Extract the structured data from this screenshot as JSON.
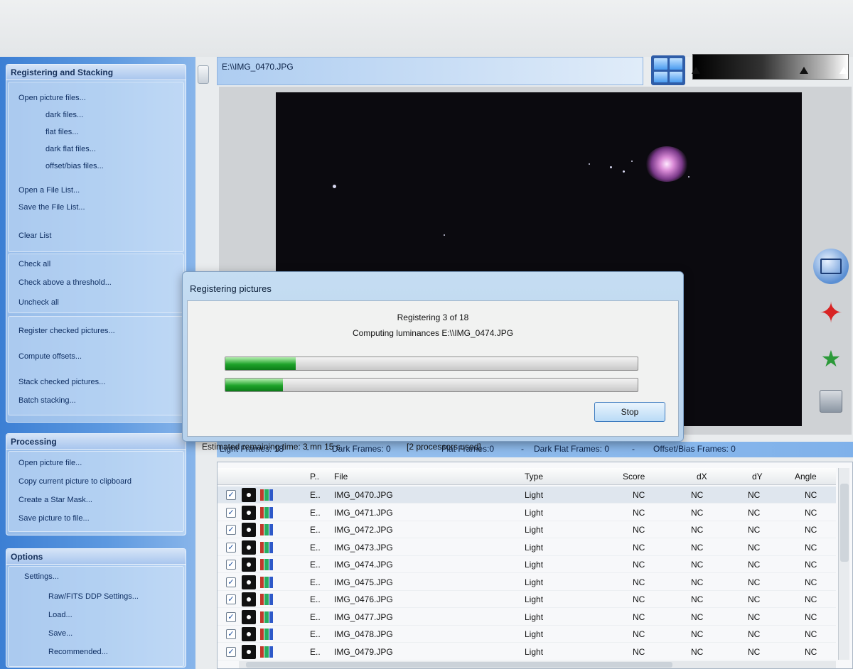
{
  "left_panel": {
    "registering": {
      "header": "Registering and Stacking",
      "items": [
        "Open picture files...",
        "dark files...",
        "flat files...",
        "dark flat files...",
        "offset/bias files...",
        "Open a File List...",
        "Save the File List...",
        "Clear List",
        "Check all",
        "Check above a threshold...",
        "Uncheck all",
        "Register checked pictures...",
        "Compute offsets...",
        "Stack checked pictures...",
        "Batch stacking..."
      ]
    },
    "processing": {
      "header": "Processing",
      "items": [
        "Open picture file...",
        "Copy current picture to clipboard",
        "Create a Star Mask...",
        "Save picture to file..."
      ]
    },
    "options": {
      "header": "Options",
      "items": [
        "Settings...",
        "Raw/FITS DDP Settings...",
        "Load...",
        "Save...",
        "Recommended..."
      ]
    }
  },
  "viewer": {
    "path": "E:\\\\IMG_0470.JPG"
  },
  "dialog": {
    "title": "Registering pictures",
    "line1": "Registering 3 of 18",
    "line2": "Computing luminances E:\\\\IMG_0474.JPG",
    "progress_overall": 0.17,
    "progress_file": 0.14,
    "remaining": "Estimated remaining time: 3 mn 15 s",
    "processors": "[2 processors used]",
    "stop_label": "Stop"
  },
  "counts": {
    "light": "Light Frames: 18",
    "dark": "Dark Frames: 0",
    "flat": "Flat Frames:0",
    "dark_flat": "Dark Flat Frames: 0",
    "offset": "Offset/Bias Frames: 0",
    "sep": "-"
  },
  "table": {
    "columns": [
      "P..",
      "File",
      "Type",
      "Score",
      "dX",
      "dY",
      "Angle"
    ],
    "rows": [
      {
        "path": "E..",
        "file": "IMG_0470.JPG",
        "type": "Light",
        "score": "NC",
        "dx": "NC",
        "dy": "NC",
        "angle": "NC",
        "check": "✓"
      },
      {
        "path": "E..",
        "file": "IMG_0471.JPG",
        "type": "Light",
        "score": "NC",
        "dx": "NC",
        "dy": "NC",
        "angle": "NC",
        "check": "✓"
      },
      {
        "path": "E..",
        "file": "IMG_0472.JPG",
        "type": "Light",
        "score": "NC",
        "dx": "NC",
        "dy": "NC",
        "angle": "NC",
        "check": "✓"
      },
      {
        "path": "E..",
        "file": "IMG_0473.JPG",
        "type": "Light",
        "score": "NC",
        "dx": "NC",
        "dy": "NC",
        "angle": "NC",
        "check": "✓"
      },
      {
        "path": "E..",
        "file": "IMG_0474.JPG",
        "type": "Light",
        "score": "NC",
        "dx": "NC",
        "dy": "NC",
        "angle": "NC",
        "check": "✓"
      },
      {
        "path": "E..",
        "file": "IMG_0475.JPG",
        "type": "Light",
        "score": "NC",
        "dx": "NC",
        "dy": "NC",
        "angle": "NC",
        "check": "✓"
      },
      {
        "path": "E..",
        "file": "IMG_0476.JPG",
        "type": "Light",
        "score": "NC",
        "dx": "NC",
        "dy": "NC",
        "angle": "NC",
        "check": "✓"
      },
      {
        "path": "E..",
        "file": "IMG_0477.JPG",
        "type": "Light",
        "score": "NC",
        "dx": "NC",
        "dy": "NC",
        "angle": "NC",
        "check": "✓"
      },
      {
        "path": "E..",
        "file": "IMG_0478.JPG",
        "type": "Light",
        "score": "NC",
        "dx": "NC",
        "dy": "NC",
        "angle": "NC",
        "check": "✓"
      },
      {
        "path": "E..",
        "file": "IMG_0479.JPG",
        "type": "Light",
        "score": "NC",
        "dx": "NC",
        "dy": "NC",
        "angle": "NC",
        "check": "✓"
      }
    ]
  },
  "icons": {
    "grid": "grid-view-icon",
    "select": "select-rect-icon",
    "star": "star-icon",
    "comet": "comet-icon",
    "save": "save-icon",
    "checkbox": "checkbox-icon",
    "frame_type": "light-frame-icon",
    "color": "rgb-icon"
  },
  "colors": {
    "panel_blue": "#3c7fd4",
    "progress_green": "#1ea32a",
    "sky_black": "#0b0a0f"
  }
}
